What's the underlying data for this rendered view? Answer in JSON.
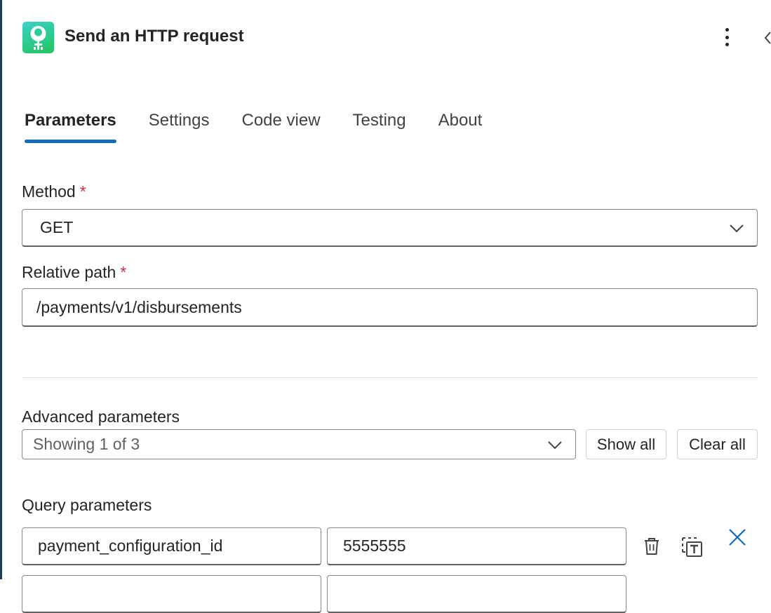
{
  "header": {
    "title": "Send an HTTP request",
    "app_icon": "connector-icon",
    "more_icon": "more-vertical-icon",
    "collapse_icon": "chevron-left-icon"
  },
  "tabs": [
    {
      "label": "Parameters",
      "active": true
    },
    {
      "label": "Settings",
      "active": false
    },
    {
      "label": "Code view",
      "active": false
    },
    {
      "label": "Testing",
      "active": false
    },
    {
      "label": "About",
      "active": false
    }
  ],
  "method": {
    "label": "Method",
    "required_marker": "*",
    "value": "GET"
  },
  "relative_path": {
    "label": "Relative path",
    "required_marker": "*",
    "value": "/payments/v1/disbursements"
  },
  "advanced": {
    "label": "Advanced parameters",
    "value": "Showing 1 of 3",
    "show_all_label": "Show all",
    "clear_all_label": "Clear all"
  },
  "query": {
    "label": "Query parameters",
    "rows": [
      {
        "key": "payment_configuration_id",
        "value": "5555555"
      }
    ]
  },
  "colors": {
    "accent": "#0f6cbd",
    "required": "#c4314b",
    "icon_gradient_start": "#3ad1c8",
    "icon_gradient_end": "#22c55e"
  }
}
